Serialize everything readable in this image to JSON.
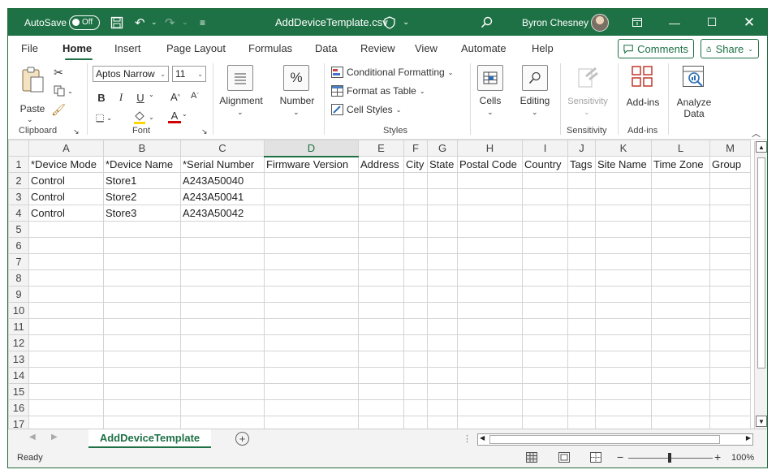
{
  "titlebar": {
    "autosave_label": "AutoSave",
    "autosave_state": "Off",
    "filename": "AddDeviceTemplate.csv",
    "user_name": "Byron Chesney"
  },
  "tabs": [
    "File",
    "Home",
    "Insert",
    "Page Layout",
    "Formulas",
    "Data",
    "Review",
    "View",
    "Automate",
    "Help"
  ],
  "active_tab": "Home",
  "top_buttons": {
    "comments": "Comments",
    "share": "Share"
  },
  "ribbon": {
    "clipboard": {
      "paste": "Paste",
      "group": "Clipboard"
    },
    "font": {
      "name": "Aptos Narrow",
      "size": "11",
      "group": "Font"
    },
    "alignment": {
      "label": "Alignment"
    },
    "number": {
      "label": "Number",
      "icon_text": "%"
    },
    "styles": {
      "conditional": "Conditional Formatting",
      "format_table": "Format as Table",
      "cell_styles": "Cell Styles",
      "group": "Styles"
    },
    "cells": {
      "label": "Cells"
    },
    "editing": {
      "label": "Editing"
    },
    "sensitivity": {
      "label": "Sensitivity",
      "group": "Sensitivity"
    },
    "addins": {
      "label": "Add-ins",
      "group": "Add-ins"
    },
    "analyze": {
      "label1": "Analyze",
      "label2": "Data"
    }
  },
  "grid": {
    "columns": [
      "A",
      "B",
      "C",
      "D",
      "E",
      "F",
      "G",
      "H",
      "I",
      "J",
      "K",
      "L",
      "M"
    ],
    "selected_column": "D",
    "rows": [
      [
        "*Device Mode",
        "*Device Name",
        "*Serial Number",
        "Firmware Version",
        "Address",
        "City",
        "State",
        "Postal Code",
        "Country",
        "Tags",
        "Site Name",
        "Time Zone",
        "Group"
      ],
      [
        "Control",
        "Store1",
        "A243A50040",
        "",
        "",
        "",
        "",
        "",
        "",
        "",
        "",
        "",
        ""
      ],
      [
        "Control",
        "Store2",
        "A243A50041",
        "",
        "",
        "",
        "",
        "",
        "",
        "",
        "",
        "",
        ""
      ],
      [
        "Control",
        "Store3",
        "A243A50042",
        "",
        "",
        "",
        "",
        "",
        "",
        "",
        "",
        "",
        ""
      ],
      [
        "",
        "",
        "",
        "",
        "",
        "",
        "",
        "",
        "",
        "",
        "",
        "",
        ""
      ],
      [
        "",
        "",
        "",
        "",
        "",
        "",
        "",
        "",
        "",
        "",
        "",
        "",
        ""
      ],
      [
        "",
        "",
        "",
        "",
        "",
        "",
        "",
        "",
        "",
        "",
        "",
        "",
        ""
      ],
      [
        "",
        "",
        "",
        "",
        "",
        "",
        "",
        "",
        "",
        "",
        "",
        "",
        ""
      ],
      [
        "",
        "",
        "",
        "",
        "",
        "",
        "",
        "",
        "",
        "",
        "",
        "",
        ""
      ],
      [
        "",
        "",
        "",
        "",
        "",
        "",
        "",
        "",
        "",
        "",
        "",
        "",
        ""
      ],
      [
        "",
        "",
        "",
        "",
        "",
        "",
        "",
        "",
        "",
        "",
        "",
        "",
        ""
      ],
      [
        "",
        "",
        "",
        "",
        "",
        "",
        "",
        "",
        "",
        "",
        "",
        "",
        ""
      ],
      [
        "",
        "",
        "",
        "",
        "",
        "",
        "",
        "",
        "",
        "",
        "",
        "",
        ""
      ],
      [
        "",
        "",
        "",
        "",
        "",
        "",
        "",
        "",
        "",
        "",
        "",
        "",
        ""
      ],
      [
        "",
        "",
        "",
        "",
        "",
        "",
        "",
        "",
        "",
        "",
        "",
        "",
        ""
      ],
      [
        "",
        "",
        "",
        "",
        "",
        "",
        "",
        "",
        "",
        "",
        "",
        "",
        ""
      ],
      [
        "",
        "",
        "",
        "",
        "",
        "",
        "",
        "",
        "",
        "",
        "",
        "",
        ""
      ]
    ]
  },
  "sheet_tab": "AddDeviceTemplate",
  "status": {
    "ready": "Ready",
    "zoom": "100%"
  }
}
